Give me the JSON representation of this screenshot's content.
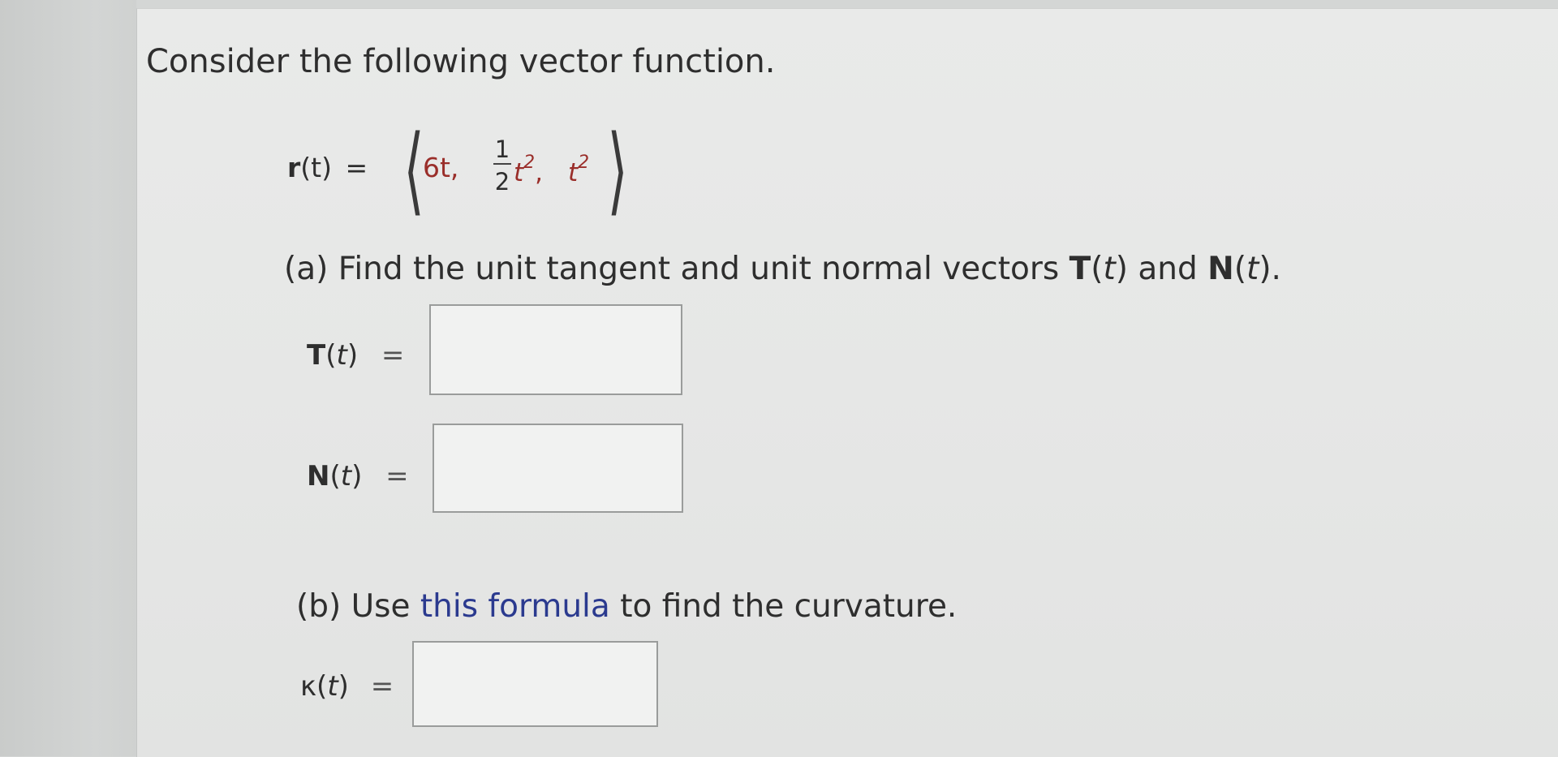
{
  "intro": "Consider the following vector function.",
  "function": {
    "name": "r",
    "arg": "(t)",
    "eq": "=",
    "comp1": "6t,",
    "frac_num": "1",
    "frac_den": "2",
    "comp2_var": "t",
    "comp2_exp": "2",
    "comma": ",",
    "comp3_var": "t",
    "comp3_exp": "2"
  },
  "part_a": {
    "prefix": "(a) Find the unit tangent and unit normal vectors ",
    "T": "T",
    "t1": "t",
    "and": " and ",
    "N": "N",
    "t2": "t",
    "tail": ".",
    "T_label": {
      "sym": "T",
      "open": "(",
      "var": "t",
      "close": ")",
      "eq": "="
    },
    "N_label": {
      "sym": "N",
      "open": "(",
      "var": "t",
      "close": ")",
      "eq": "="
    },
    "T_value": "",
    "N_value": ""
  },
  "part_b": {
    "prefix": "(b) Use ",
    "link": "this formula",
    "suffix": " to find the curvature.",
    "kappa_label": {
      "sym": "κ",
      "open": "(",
      "var": "t",
      "close": ")",
      "eq": "="
    },
    "kappa_value": ""
  }
}
